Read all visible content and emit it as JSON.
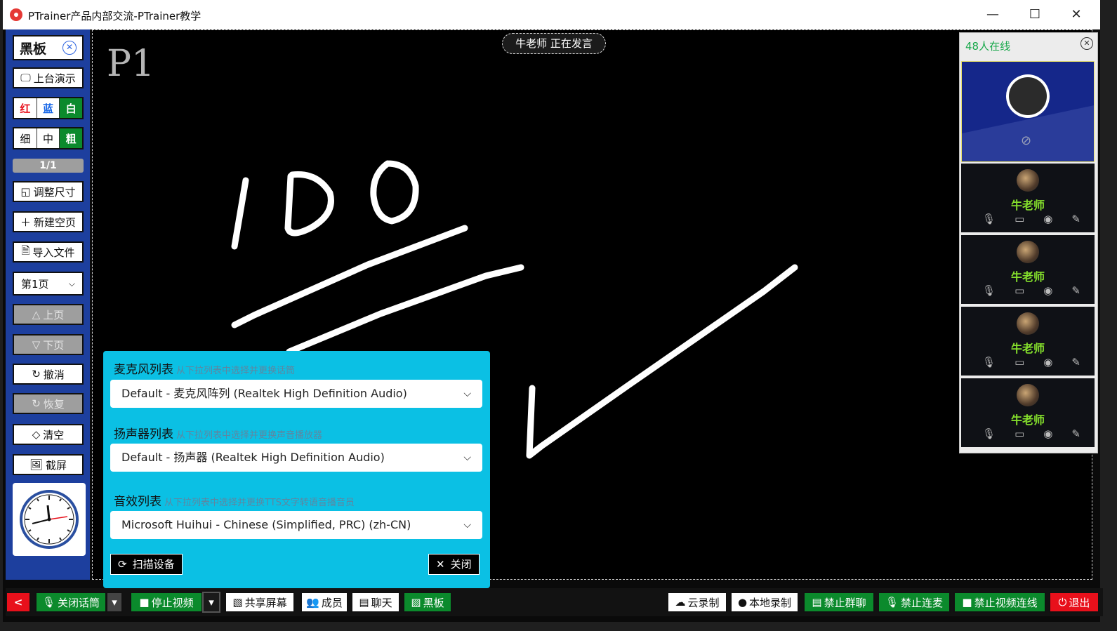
{
  "window": {
    "title": "PTrainer产品内部交流-PTrainer教学",
    "minimize": "—",
    "maximize": "☐",
    "close": "✕"
  },
  "left": {
    "board_title": "黑板",
    "present": "上台演示",
    "colors": [
      "红",
      "蓝",
      "白"
    ],
    "color_values": [
      "#e8101b",
      "#1565e6",
      "#0b8a2c"
    ],
    "sizes": [
      "细",
      "中",
      "粗"
    ],
    "page_counter": "1/1",
    "resize": "调整尺寸",
    "new_page": "新建空页",
    "import": "导入文件",
    "page_select": "第1页",
    "prev": "上页",
    "next": "下页",
    "undo": "撤消",
    "redo": "恢复",
    "clear": "清空",
    "screenshot": "截屏"
  },
  "board": {
    "page_label": "P1",
    "speaking": "牛老师 正在发言"
  },
  "right": {
    "online": "48人在线",
    "members": [
      {
        "name": "牛老师"
      },
      {
        "name": "牛老师"
      },
      {
        "name": "牛老师"
      },
      {
        "name": "牛老师"
      }
    ]
  },
  "dialog": {
    "mic_label": "麦克风列表",
    "mic_hint": "从下拉列表中选择并更换话筒",
    "mic_value": "Default - 麦克风阵列 (Realtek High Definition Audio)",
    "spk_label": "扬声器列表",
    "spk_hint": "从下拉列表中选择并更换声音播放器",
    "spk_value": "Default - 扬声器 (Realtek High Definition Audio)",
    "sfx_label": "音效列表",
    "sfx_hint": "从下拉列表中选择并更换TTS文字转语音播音员",
    "sfx_value": "Microsoft Huihui - Chinese (Simplified, PRC) (zh-CN)",
    "scan": "扫描设备",
    "close": "关闭"
  },
  "bottom": {
    "back": "<",
    "mic": "关闭话筒",
    "video": "停止视频",
    "share": "共享屏幕",
    "members": "成员",
    "chat": "聊天",
    "board": "黑板",
    "cloud": "云录制",
    "local": "本地录制",
    "ban_chat": "禁止群聊",
    "ban_mic": "禁止连麦",
    "ban_video": "禁止视频连线",
    "exit": "退出"
  }
}
